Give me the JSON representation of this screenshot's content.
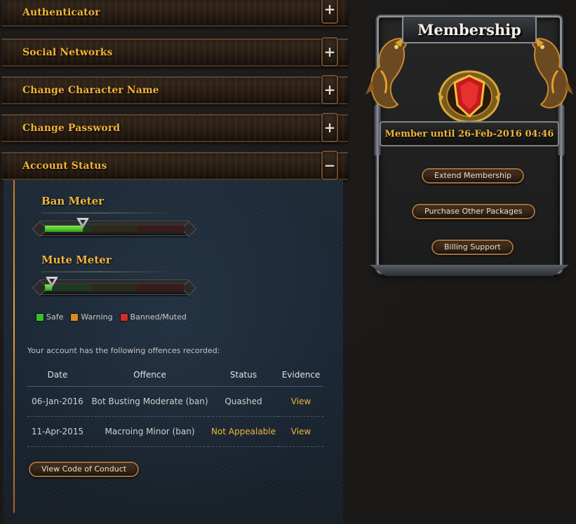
{
  "accordion": [
    {
      "label": "Authenticator",
      "toggle": "+"
    },
    {
      "label": "Social Networks",
      "toggle": "+"
    },
    {
      "label": "Change Character Name",
      "toggle": "+"
    },
    {
      "label": "Change Password",
      "toggle": "+"
    },
    {
      "label": "Account Status",
      "toggle": "−"
    }
  ],
  "account_status": {
    "ban_meter": {
      "title": "Ban Meter",
      "level": 0.27
    },
    "mute_meter": {
      "title": "Mute Meter",
      "level": 0.05
    },
    "legend": [
      {
        "label": "Safe",
        "color": "#34c22a"
      },
      {
        "label": "Warning",
        "color": "#e08a1e"
      },
      {
        "label": "Banned/Muted",
        "color": "#d42a2a"
      }
    ],
    "offences_intro": "Your account has the following offences recorded:",
    "table": {
      "headers": [
        "Date",
        "Offence",
        "Status",
        "Evidence"
      ],
      "rows": [
        {
          "date": "06-Jan-2016",
          "offence": "Bot Busting Moderate (ban)",
          "status": "Quashed",
          "evidence": "View"
        },
        {
          "date": "11-Apr-2015",
          "offence": "Macroing Minor (ban)",
          "status": "Not Appealable",
          "evidence": "View"
        }
      ]
    },
    "code_of_conduct_label": "View Code of Conduct"
  },
  "membership": {
    "title": "Membership",
    "member_until": "Member until 26-Feb-2016 04:46",
    "buttons": {
      "extend": "Extend Membership",
      "purchase": "Purchase Other Packages",
      "billing": "Billing Support"
    }
  },
  "colors": {
    "accent_gold": "#f0b43a",
    "panel_blue": "#1d2a36"
  }
}
